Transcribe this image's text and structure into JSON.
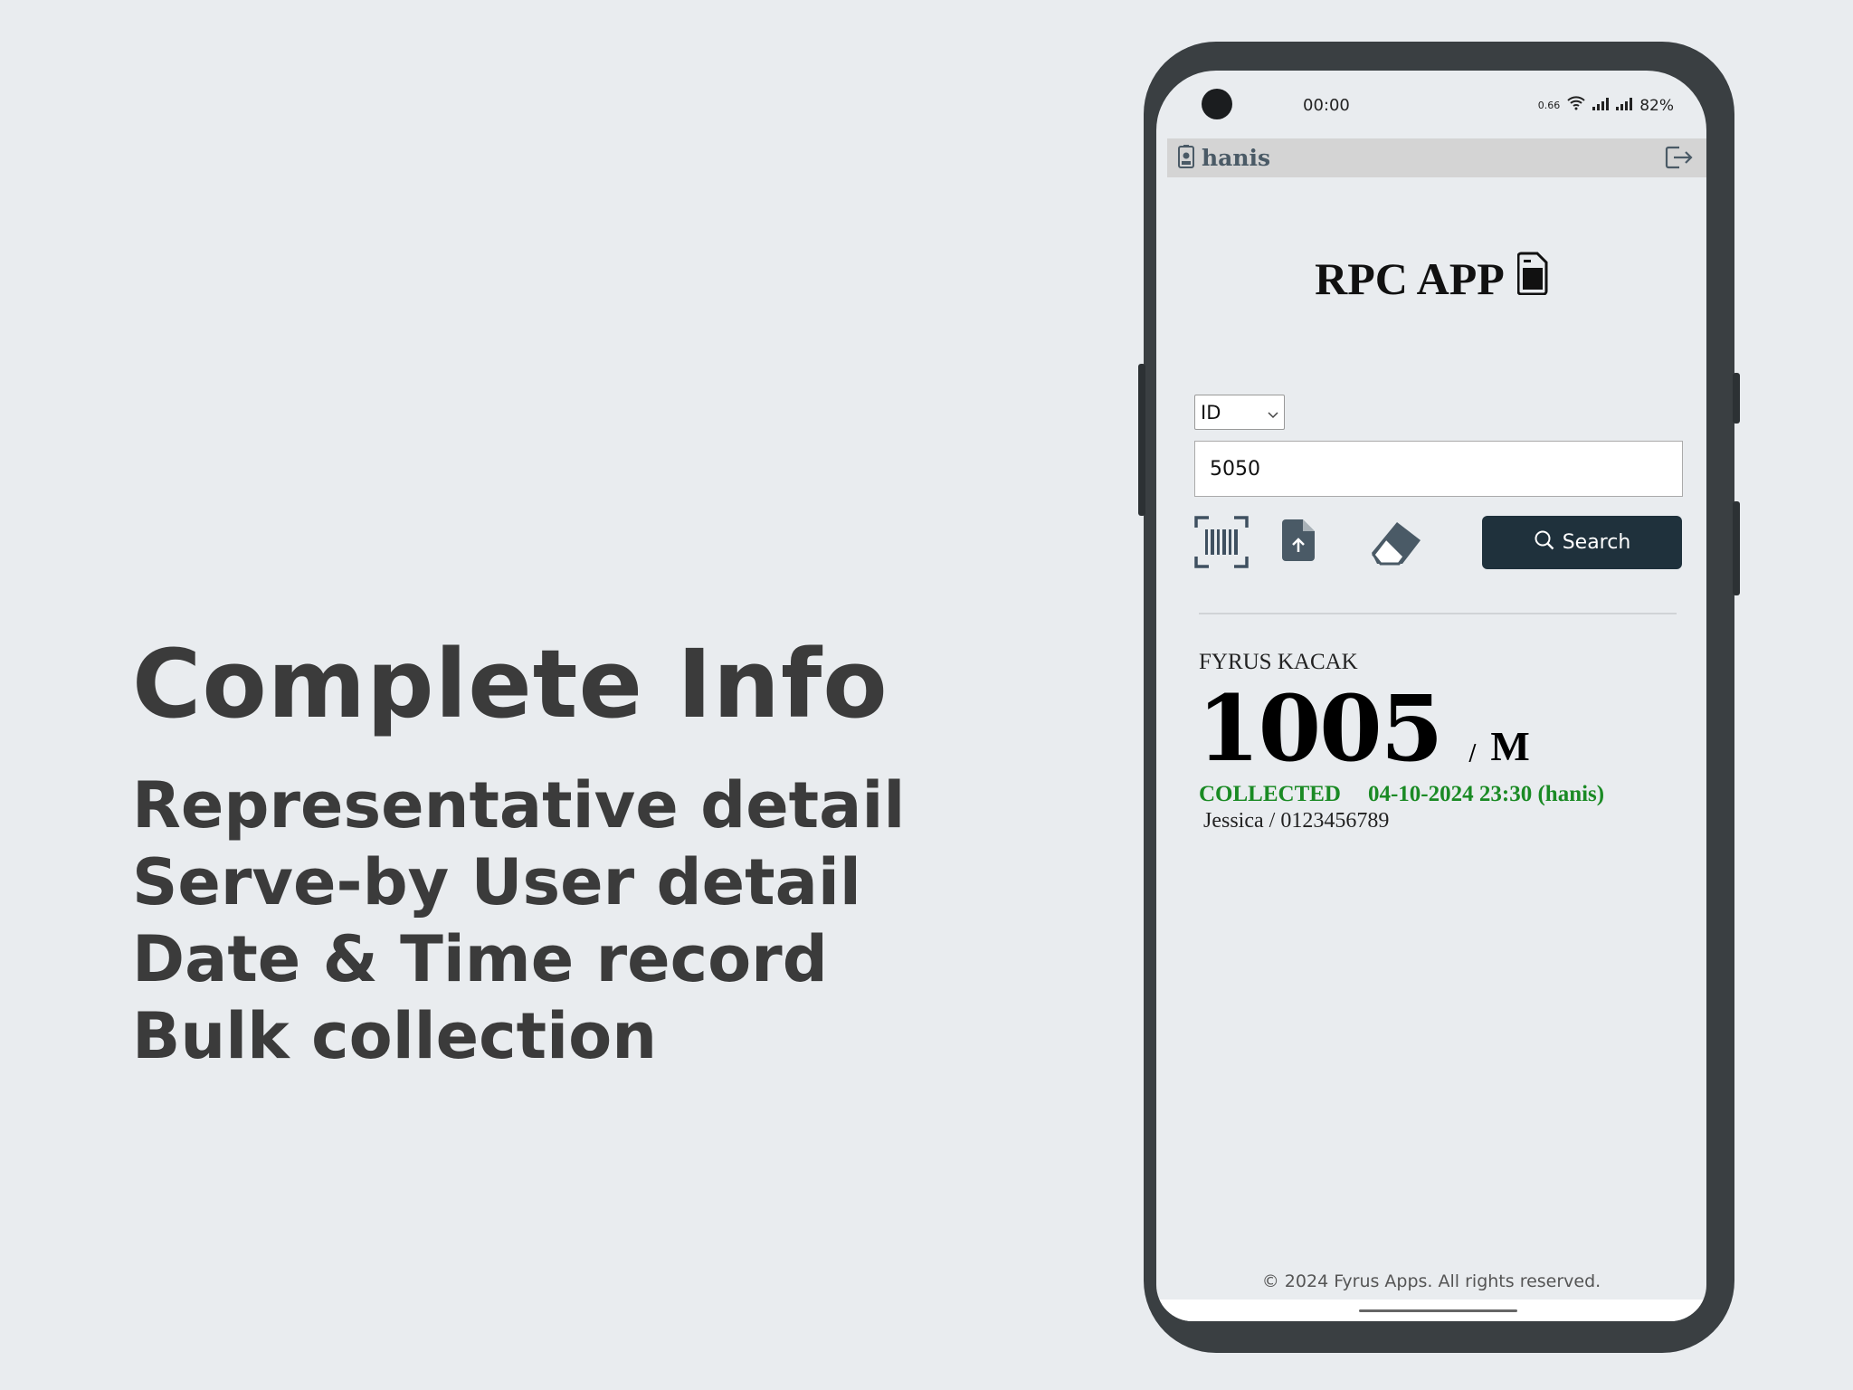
{
  "promo": {
    "title": "Complete Info",
    "lines": [
      "Representative detail",
      "Serve-by User detail",
      "Date & Time record",
      "Bulk collection"
    ]
  },
  "status_bar": {
    "time": "00:00",
    "data_speed": "0.66",
    "battery": "82%"
  },
  "header": {
    "username": "hanis"
  },
  "app": {
    "title": "RPC APP"
  },
  "search": {
    "type_selected": "ID",
    "query": "5050",
    "button_label": "Search"
  },
  "result": {
    "name": "FYRUS KACAK",
    "number": "1005",
    "separator": "/",
    "gender": "M",
    "status": "COLLECTED",
    "collected_at": "04-10-2024 23:30 (hanis)",
    "representative": "Jessica / 0123456789"
  },
  "footer": {
    "copyright": "© 2024 Fyrus Apps. All rights reserved."
  }
}
